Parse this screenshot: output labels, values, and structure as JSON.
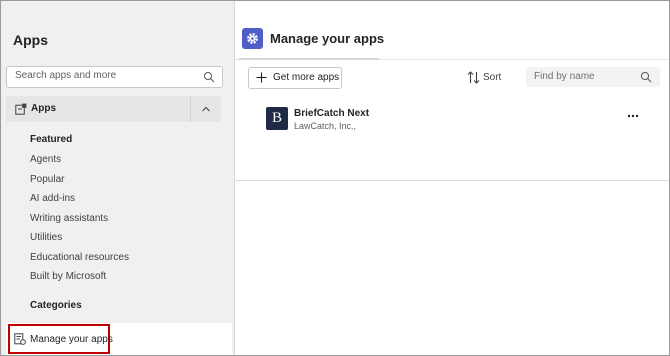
{
  "window": {
    "close_label": "×"
  },
  "sidebar": {
    "title": "Apps",
    "search": {
      "placeholder": "Search apps and more"
    },
    "apps_section_label": "Apps",
    "featured_heading": "Featured",
    "featured_items": [
      "Agents",
      "Popular",
      "AI add-ins",
      "Writing assistants",
      "Utilities",
      "Educational resources",
      "Built by Microsoft"
    ],
    "categories_heading": "Categories",
    "manage_label": "Manage your apps"
  },
  "main": {
    "title": "Manage your apps",
    "get_more_label": "Get more apps",
    "sort_label": "Sort",
    "find": {
      "placeholder": "Find by name"
    },
    "apps": [
      {
        "name": "BriefCatch Next",
        "publisher": "LawCatch, Inc.,",
        "logo_letter": "B"
      }
    ]
  },
  "colors": {
    "accent": "#4f5fc7",
    "highlight_border": "#c00000",
    "app_logo_bg": "#1f2a44"
  }
}
